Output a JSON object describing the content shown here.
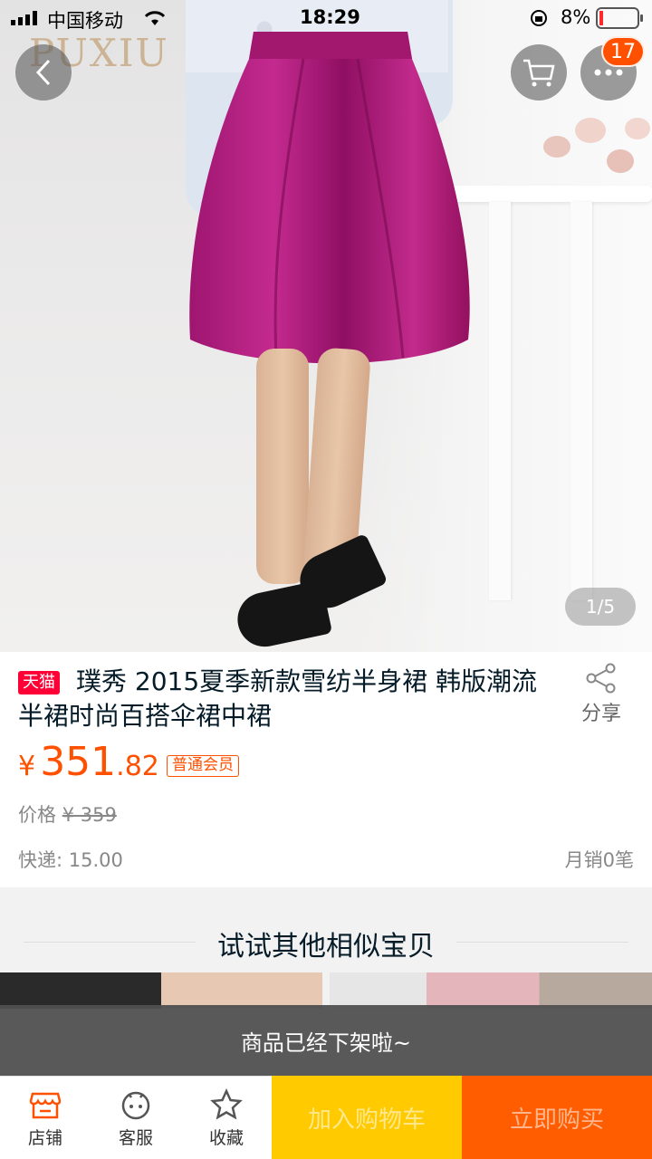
{
  "status_bar": {
    "carrier": "中国移动",
    "time": "18:29",
    "battery": "8%"
  },
  "hero": {
    "brand_logo": "PUXIU",
    "pager": "1/5",
    "cart_badge": "17"
  },
  "product": {
    "platform_tag": "天猫",
    "title": "璞秀 2015夏季新款雪纺半身裙 韩版潮流半裙时尚百搭伞裙中裙",
    "share_label": "分享",
    "price_currency": "¥",
    "price_int": "351",
    "price_dec": ".82",
    "member_tag": "普通会员",
    "original_label": "价格",
    "original_price": "¥ 359",
    "shipping": "快递: 15.00",
    "monthly_sales": "月销0笔"
  },
  "similar": {
    "title": "试试其他相似宝贝"
  },
  "offline_notice": "商品已经下架啦~",
  "bottom_bar": {
    "shop": "店铺",
    "service": "客服",
    "favorite": "收藏",
    "add_cart": "加入购物车",
    "buy_now": "立即购买"
  },
  "colors": {
    "accent": "#ff5000",
    "tmall": "#ff0036",
    "cart_btn": "#ffcb00",
    "buy_btn": "#ff5d00"
  }
}
